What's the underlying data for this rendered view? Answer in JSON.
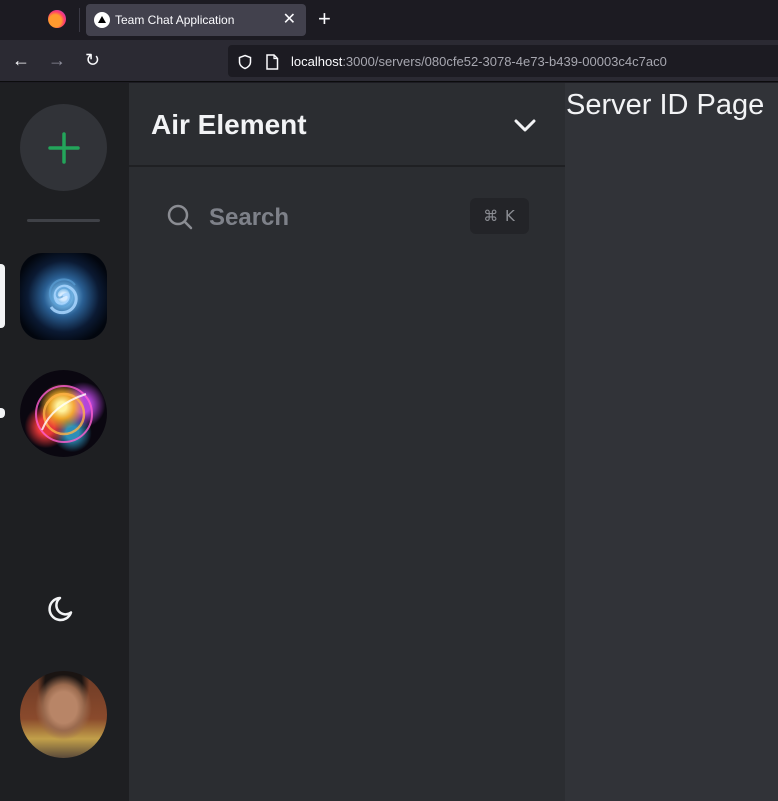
{
  "browser": {
    "tab": {
      "title": "Team Chat Application"
    },
    "url": {
      "host": "localhost",
      "path": ":3000/servers/080cfe52-3078-4e73-b439-00003c4c7ac0"
    }
  },
  "server": {
    "name": "Air Element"
  },
  "search": {
    "label": "Search",
    "shortcut": "⌘ K"
  },
  "main": {
    "title": "Server ID Page"
  }
}
